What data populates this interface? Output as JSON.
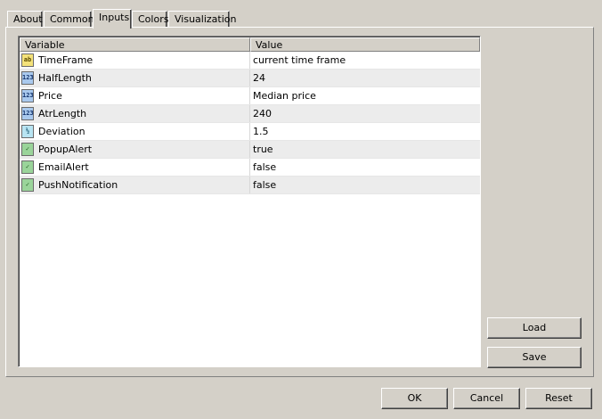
{
  "tabs": [
    {
      "label": "About"
    },
    {
      "label": "Common"
    },
    {
      "label": "Inputs"
    },
    {
      "label": "Colors"
    },
    {
      "label": "Visualization"
    }
  ],
  "active_tab": "Inputs",
  "grid": {
    "columns": [
      "Variable",
      "Value"
    ],
    "rows": [
      {
        "name": "TimeFrame",
        "value": "current time frame",
        "icon": "string-type-icon",
        "icon_text": "ab"
      },
      {
        "name": "HalfLength",
        "value": "24",
        "icon": "integer-type-icon",
        "icon_text": "123"
      },
      {
        "name": "Price",
        "value": "Median price",
        "icon": "integer-type-icon",
        "icon_text": "123"
      },
      {
        "name": "AtrLength",
        "value": "240",
        "icon": "integer-type-icon",
        "icon_text": "123"
      },
      {
        "name": "Deviation",
        "value": "1.5",
        "icon": "double-type-icon",
        "icon_text": "½"
      },
      {
        "name": "PopupAlert",
        "value": "true",
        "icon": "bool-type-icon",
        "icon_text": "✓"
      },
      {
        "name": "EmailAlert",
        "value": "false",
        "icon": "bool-type-icon",
        "icon_text": "✓"
      },
      {
        "name": "PushNotification",
        "value": "false",
        "icon": "bool-type-icon",
        "icon_text": "✓"
      }
    ]
  },
  "side_buttons": {
    "load": "Load",
    "save": "Save"
  },
  "footer_buttons": {
    "ok": "OK",
    "cancel": "Cancel",
    "reset": "Reset"
  }
}
